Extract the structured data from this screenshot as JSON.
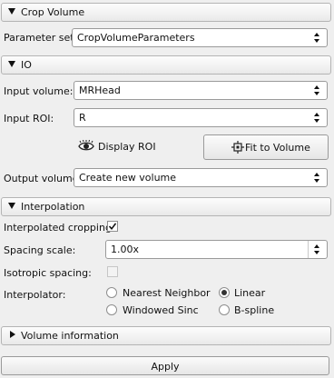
{
  "crop_volume": {
    "header": "Crop Volume",
    "parameter_set_label": "Parameter set:",
    "parameter_set_value": "CropVolumeParameters"
  },
  "io": {
    "header": "IO",
    "input_volume_label": "Input volume:",
    "input_volume_value": "MRHead",
    "input_roi_label": "Input ROI:",
    "input_roi_value": "R",
    "display_roi_label": "Display ROI",
    "fit_to_volume_label": "Fit to Volume",
    "output_volume_label": "Output volume:",
    "output_volume_value": "Create new volume"
  },
  "interpolation": {
    "header": "Interpolation",
    "interpolated_cropping_label": "Interpolated cropping:",
    "interpolated_cropping_checked": true,
    "spacing_scale_label": "Spacing scale:",
    "spacing_scale_value": "1.00x",
    "isotropic_spacing_label": "Isotropic spacing:",
    "isotropic_spacing_checked": false,
    "interpolator_label": "Interpolator:",
    "interpolator_options": [
      "Nearest Neighbor",
      "Linear",
      "Windowed Sinc",
      "B-spline"
    ],
    "interpolator_selected": "Linear"
  },
  "volume_information": {
    "header": "Volume information"
  },
  "apply_label": "Apply",
  "icons": {
    "expanded": "triangle-down-icon",
    "collapsed": "triangle-right-icon",
    "display_roi": "eye-icon",
    "fit_to_volume": "fit-to-volume-icon",
    "checkmark": "checkmark-icon"
  }
}
